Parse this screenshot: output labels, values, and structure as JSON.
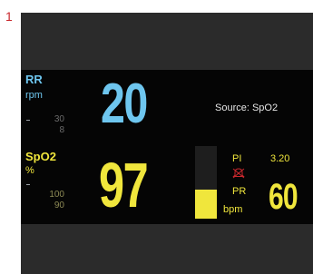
{
  "figure_label": "1",
  "colors": {
    "rr": "#6ec6ef",
    "spo2": "#f0e63c",
    "bezel": "#2b2b2b",
    "panel": "#050505",
    "limit_text": "#6b6b6b",
    "accent_red": "#c8282d"
  },
  "rr": {
    "label": "RR",
    "unit": "rpm",
    "value": "20",
    "limit_high": "30",
    "limit_low": "8"
  },
  "source": {
    "text": "Source: SpO2"
  },
  "spo2": {
    "label": "SpO2",
    "unit": "%",
    "value": "97",
    "limit_high": "100",
    "limit_low": "90",
    "perfusion_bar_fraction": 0.4
  },
  "pi": {
    "label": "PI",
    "value": "3.20",
    "alarm_icon": "alarm-off-icon"
  },
  "pr": {
    "label": "PR",
    "unit": "bpm",
    "value": "60"
  }
}
